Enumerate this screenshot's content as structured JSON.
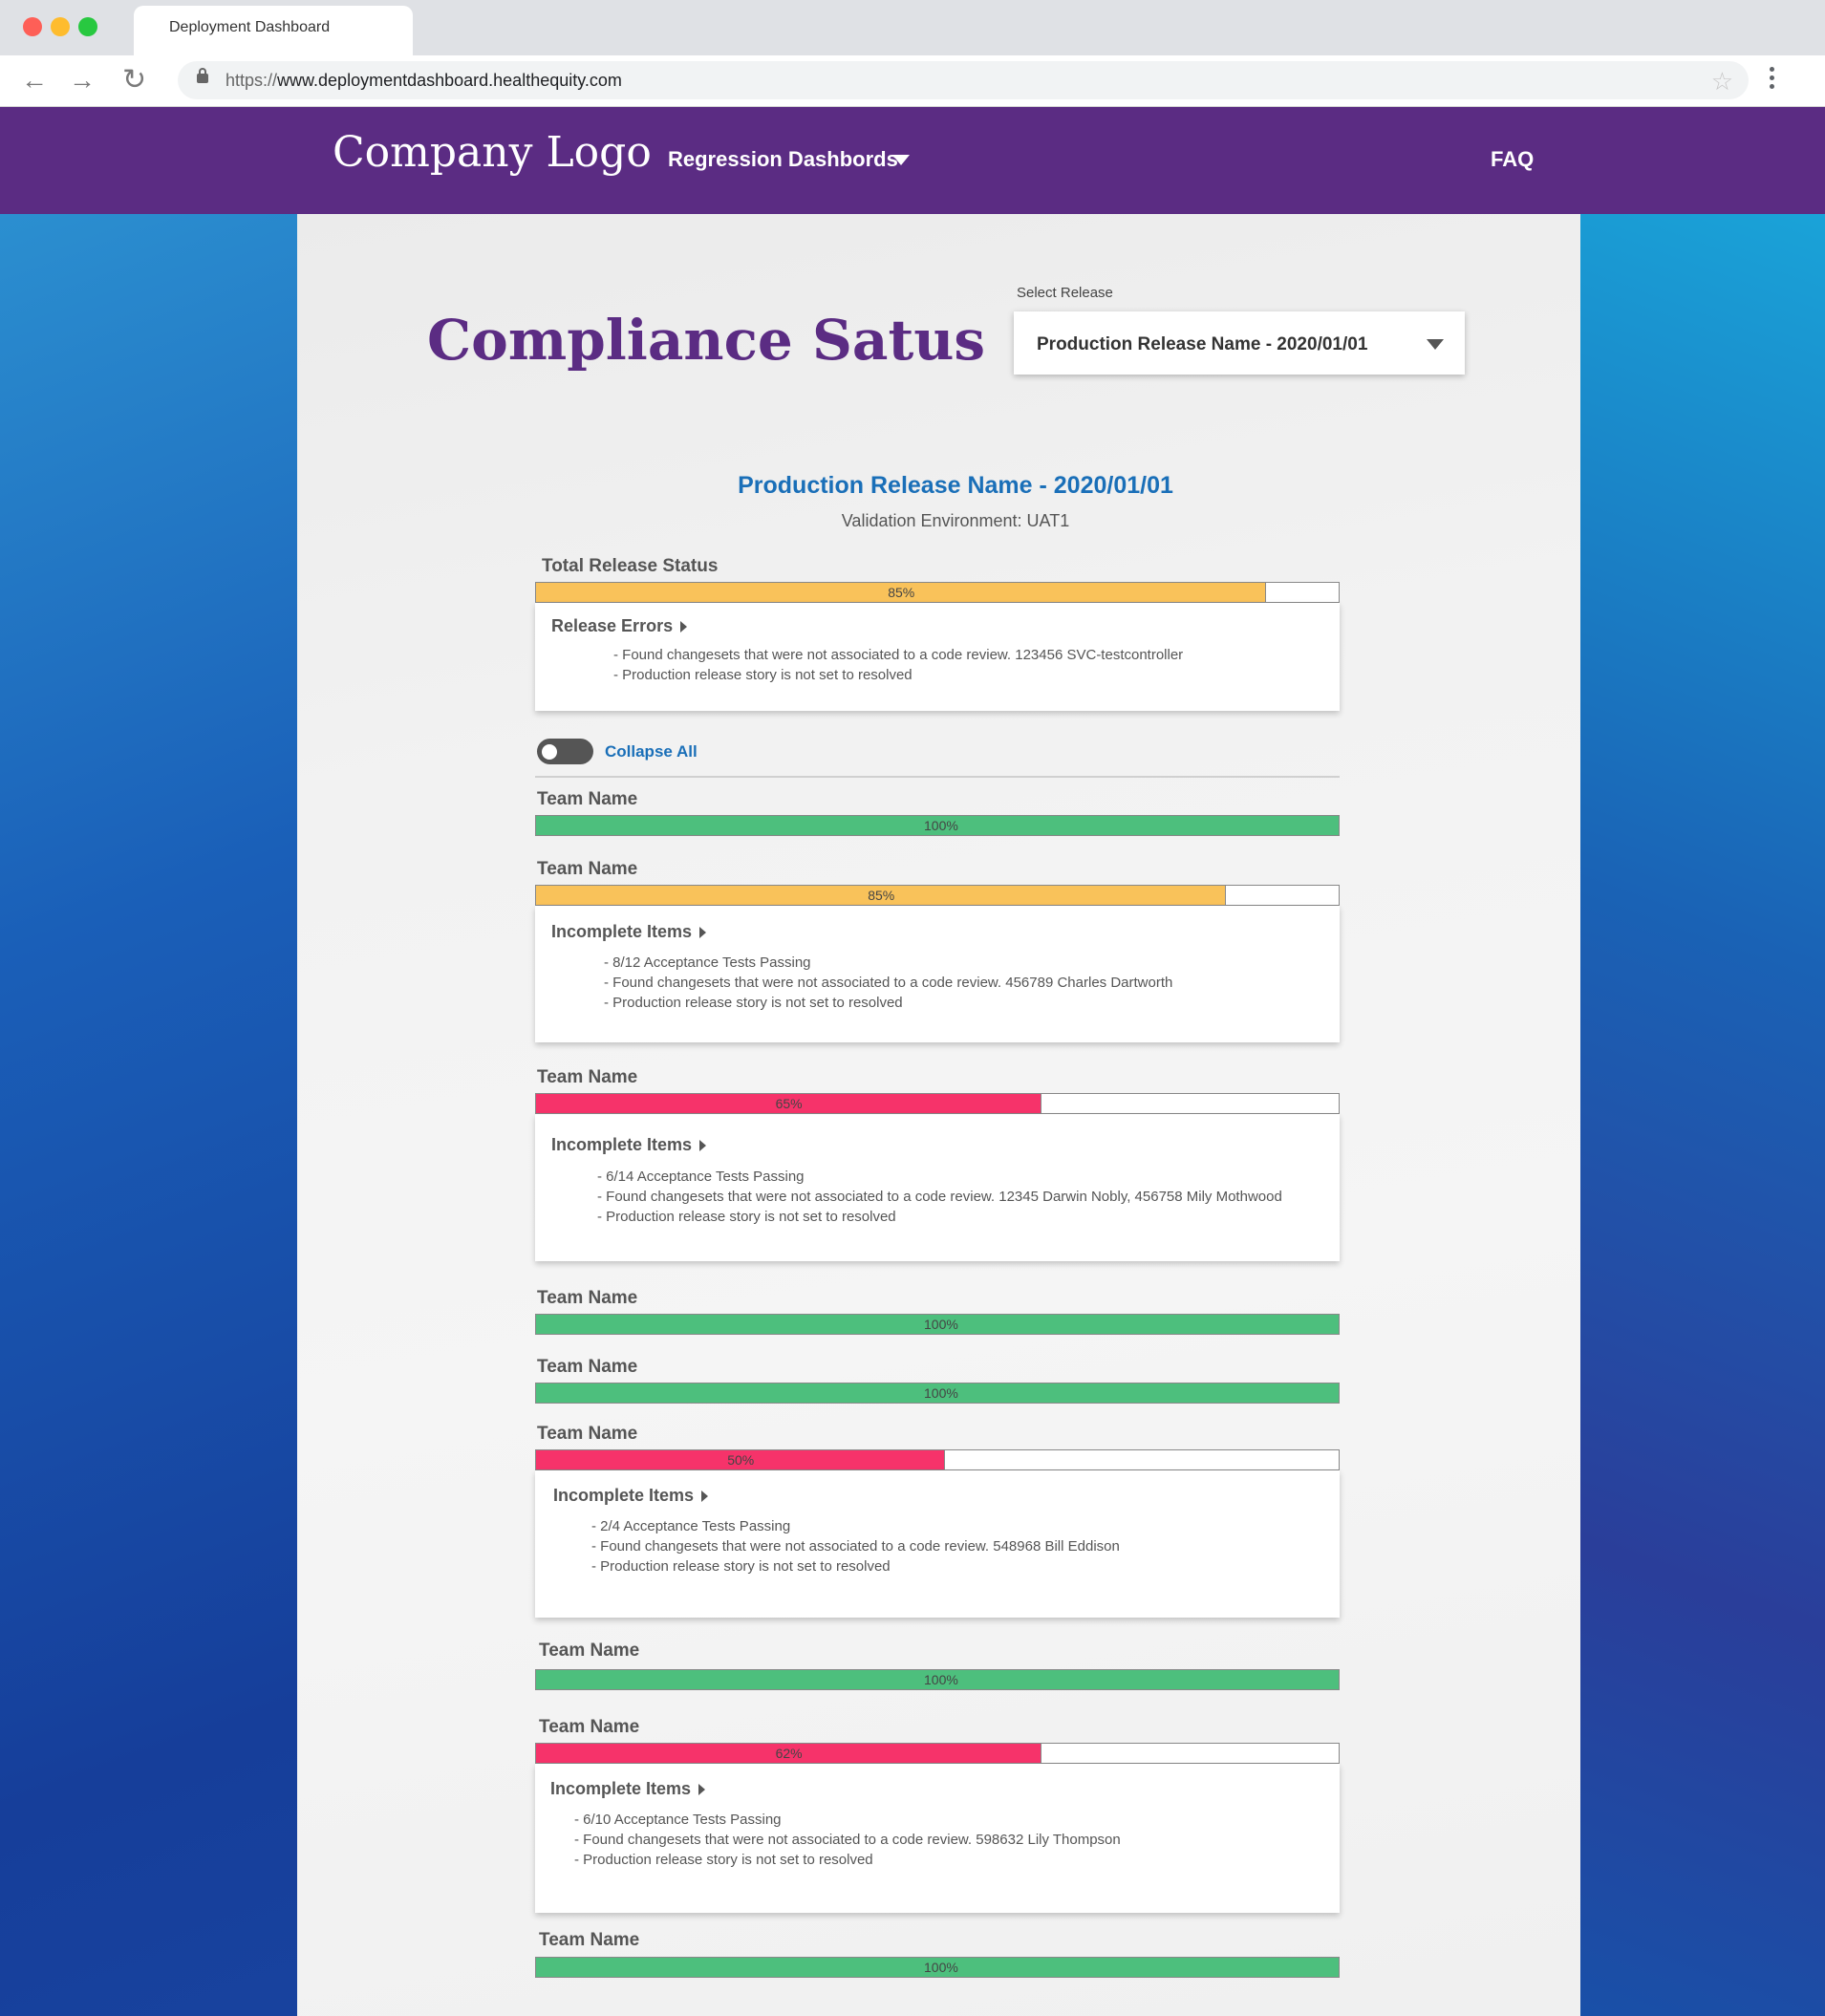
{
  "browser": {
    "tab_title": "Deployment Dashboard",
    "url_scheme": "https://",
    "url_host": "www.deploymentdashboard.healthequity.com"
  },
  "nav": {
    "logo": "Company Logo",
    "dashboards_label": "Regression Dashbords",
    "faq_label": "FAQ"
  },
  "page": {
    "title": "Compliance Satus",
    "select_label": "Select Release",
    "select_value": "Production Release Name - 2020/01/01",
    "release_title": "Production Release Name - 2020/01/01",
    "environment": "Validation Environment: UAT1",
    "collapse_all": "Collapse All"
  },
  "colors": {
    "warning": "#f9c25a",
    "success": "#4dbf7d",
    "danger": "#f6336a",
    "brand": "#5b2c83",
    "link": "#1a6fb8"
  },
  "total": {
    "label": "Total Release Status",
    "percent": 91,
    "percent_label": "85%",
    "status": "warning",
    "card_title": "Release Errors",
    "items": [
      "- Found changesets that were not associated to a code review. 123456 SVC-testcontroller",
      "- Production release story is not set to resolved"
    ]
  },
  "teams": [
    {
      "name": "Team Name",
      "percent": 100,
      "percent_label": "100%",
      "status": "success"
    },
    {
      "name": "Team Name",
      "percent": 86,
      "percent_label": "85%",
      "status": "warning",
      "card_title": "Incomplete Items",
      "items": [
        "- 8/12 Acceptance Tests Passing",
        "- Found changesets that were not associated to a code review. 456789 Charles Dartworth",
        "- Production release story is not set to resolved"
      ]
    },
    {
      "name": "Team Name",
      "percent": 63,
      "percent_label": "65%",
      "status": "danger",
      "card_title": "Incomplete Items",
      "items": [
        "- 6/14 Acceptance Tests Passing",
        "- Found changesets that were not associated to a code review. 12345 Darwin Nobly, 456758 Mily Mothwood",
        "- Production release story is not set to resolved"
      ]
    },
    {
      "name": "Team Name",
      "percent": 100,
      "percent_label": "100%",
      "status": "success"
    },
    {
      "name": "Team Name",
      "percent": 100,
      "percent_label": "100%",
      "status": "success"
    },
    {
      "name": "Team Name",
      "percent": 51,
      "percent_label": "50%",
      "status": "danger",
      "card_title": "Incomplete Items",
      "items": [
        "- 2/4 Acceptance Tests Passing",
        "- Found changesets that were not associated to a code review. 548968 Bill Eddison",
        "- Production release story is not set to resolved"
      ]
    },
    {
      "name": "Team Name",
      "percent": 100,
      "percent_label": "100%",
      "status": "success"
    },
    {
      "name": "Team Name",
      "percent": 63,
      "percent_label": "62%",
      "status": "danger",
      "card_title": "Incomplete Items",
      "items": [
        "- 6/10 Acceptance Tests Passing",
        "- Found changesets that were not associated to a code review. 598632 Lily Thompson",
        "- Production release story is not set to resolved"
      ]
    },
    {
      "name": "Team Name",
      "percent": 100,
      "percent_label": "100%",
      "status": "success"
    }
  ]
}
